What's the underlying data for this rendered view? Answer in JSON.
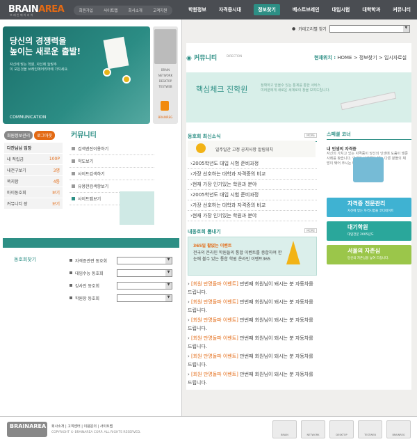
{
  "header": {
    "logo_brain": "BRAIN",
    "logo_area": "AREA",
    "logo_sub": "브 레 인 에 어 리 어",
    "toplinks": [
      "회원가입",
      "사이트맵",
      "회사소개",
      "고객지원"
    ],
    "nav": [
      "학원정보",
      "자격증시대",
      "정보찾기",
      "베스트브레인",
      "대입시험",
      "대학학과",
      "커뮤니티"
    ]
  },
  "hero": {
    "title1": "당신의 경쟁력을",
    "title2": "높이는 새로운 출발!",
    "sub1": "자신에 맞는 학원, 자신에 늘맞추",
    "sub2": "이 모든것을 브레인에어리어에 가지세요.",
    "comm": "COMMUNICATION"
  },
  "side": {
    "labels": [
      "BRAIN",
      "NETWORK",
      "DESKTOP",
      "TESTWEB"
    ],
    "sub": "BRAINREG"
  },
  "member": {
    "tab1": "회원정보관리",
    "tab2": "로그아웃",
    "rows": [
      {
        "k": "다잔님님 입장",
        "v": ""
      },
      {
        "k": "내 적립금",
        "v": "100P"
      },
      {
        "k": "내전구보기",
        "v": "3명"
      },
      {
        "k": "쪽지함",
        "v": "4통"
      },
      {
        "k": "마이동호회",
        "v": "보기"
      },
      {
        "k": "커뮤니티 장",
        "v": "보기"
      }
    ]
  },
  "community": {
    "title": "커뮤니티",
    "items": [
      "검색엔진이용하기",
      "약도보기",
      "사이트검색하기",
      "유용한검색항보기",
      "사이트맵보기"
    ]
  },
  "find": {
    "title": "동호회찾기",
    "rows": [
      "자격증관련 동호회",
      "대입수능 동호회",
      "강사진 동호회",
      "학원장 동호회"
    ]
  },
  "category": {
    "label": "카테고리별 찾기"
  },
  "crumb": {
    "title": "커뮤니티",
    "dir": "DIRECTION",
    "here": "현재위치 :",
    "path": "HOME > 정보찾기 > 입시자료실"
  },
  "banner": {
    "title": "핵심체크 진학원",
    "sub1": "정확하고 믿을수 있는 통계를 통한 서비스",
    "sub2": "여러분에게 새로운 세계로의 창을 보여드립니다."
  },
  "news": {
    "title": "동호회 최신소식",
    "more": "MORE",
    "notice": "일주일간 고정 공지사항 알림위치",
    "items": [
      "2005학년도 대입 시험 준비과정",
      "가장 선호하는 대학과 자격증의 비교",
      "현재 가장 인기있는 학원과 분야",
      "2005학년도 대입 시험 준비과정",
      "가장 선호하는 대학과 자격증의 비교",
      "현재 가장 인기있는 학원과 분야"
    ]
  },
  "event": {
    "title": "내동호회 뽐내기",
    "more": "MORE",
    "head": "365일 활없는 이벤트",
    "body": "전국의 온라인 학원들의 통합 이벤트를 종합하여 한눈에 볼수 있는 통합 학원 온라인 이벤트365"
  },
  "events": [
    {
      "h": "[회원 만명돌파 이벤트]",
      "b": "만번째 회원님이 돼시는 분 자동차를 드립니다."
    },
    {
      "h": "[회원 만명돌파 이벤트]",
      "b": "만번째 회원님이 돼시는 분 자동차를 드립니다."
    },
    {
      "h": "[회원 만명돌파 이벤트]",
      "b": "만번째 회원님이 돼시는 분 자동차를 드립니다."
    },
    {
      "h": "[회원 만명돌파 이벤트]",
      "b": "만번째 회원님이 돼시는 분 자동차를 드립니다."
    },
    {
      "h": "[회원 만명돌파 이벤트]",
      "b": "만번째 회원님이 돼시는 분 자동차를 드립니다."
    },
    {
      "h": "[회원 만명돌파 이벤트]",
      "b": "만번째 회원님이 돼시는 분 자동차를 드립니다."
    }
  ],
  "style": {
    "title": "스페셜 코너",
    "head": "내 인생의 자격증",
    "body": "자신의 가치고 있는 자격증이 당신의 인생에 도움이 돼준 사례를 찾습니다. 인생의 사례했던 해는 다른 분들의 채방이 돼어 주시는 바랍니다."
  },
  "promos": [
    {
      "t": "자격증 전문관리",
      "s": "자신에 맞는 자격시험을 코디네이트",
      "color": "#3fb2d2"
    },
    {
      "t": "대기학원",
      "s": "대입전문 2005년도",
      "color": "#2aa79b"
    },
    {
      "t": "서울의 자존심",
      "s": "당신의 자존심을 높여 드립니다.",
      "color": "#9bc64a"
    }
  ],
  "footer": {
    "logo": "BRAINAREA",
    "links": "회사소개 | 고객센터 | 이용문의 | 사이트맵",
    "copy": "COPYRIGHT © BRAINAREA CORP. ALL RIGHTS RESERVED.",
    "icons": [
      "BRAIN",
      "NETWORK",
      "DESKTOP",
      "TESTWEB",
      "BRAINREG"
    ]
  }
}
